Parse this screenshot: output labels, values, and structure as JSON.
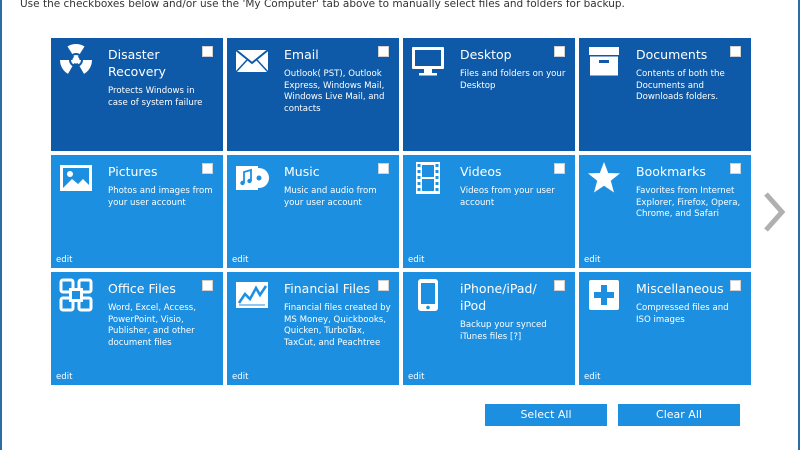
{
  "instruction": "Use the checkboxes below and/or use the 'My Computer' tab above to manually select files and folders for backup.",
  "tiles": [
    {
      "title": "Disaster Recovery",
      "desc": "Protects Windows in case of system failure",
      "icon": "radiation-icon",
      "edit": ""
    },
    {
      "title": "Email",
      "desc": "Outlook( PST), Outlook Express, Windows Mail, Windows Live Mail, and contacts",
      "icon": "envelope-icon",
      "edit": ""
    },
    {
      "title": "Desktop",
      "desc": "Files and folders on your Desktop",
      "icon": "monitor-icon",
      "edit": ""
    },
    {
      "title": "Documents",
      "desc": "Contents of both the Documents and Downloads folders.",
      "icon": "file-box-icon",
      "edit": ""
    },
    {
      "title": "Pictures",
      "desc": "Photos and images from your user account",
      "icon": "picture-icon",
      "edit": "edit"
    },
    {
      "title": "Music",
      "desc": "Music and audio from your user account",
      "icon": "music-icon",
      "edit": "edit"
    },
    {
      "title": "Videos",
      "desc": "Videos from your user account",
      "icon": "film-icon",
      "edit": "edit"
    },
    {
      "title": "Bookmarks",
      "desc": "Favorites from Internet Explorer, Firefox, Opera, Chrome, and Safari",
      "icon": "star-icon",
      "edit": "edit"
    },
    {
      "title": "Office Files",
      "desc": "Word, Excel, Access, PowerPoint, Visio, Publisher, and other document files",
      "icon": "office-icon",
      "edit": "edit"
    },
    {
      "title": "Financial Files",
      "desc": "Financial files created by MS Money, Quickbooks, Quicken, TurboTax, TaxCut, and Peachtree",
      "icon": "chart-icon",
      "edit": "edit"
    },
    {
      "title": "iPhone/iPad/ iPod",
      "desc": "Backup your synced iTunes files [?]",
      "icon": "phone-icon",
      "edit": "edit"
    },
    {
      "title": "Miscellaneous",
      "desc": "Compressed files and ISO images",
      "icon": "plus-icon",
      "edit": "edit"
    }
  ],
  "buttons": {
    "select_all": "Select All",
    "clear_all": "Clear All"
  },
  "colors": {
    "tile_dark": "#0f5aa8",
    "tile_light": "#1d8fe0",
    "button": "#1d8fe0",
    "arrow": "#b0b0b0"
  }
}
